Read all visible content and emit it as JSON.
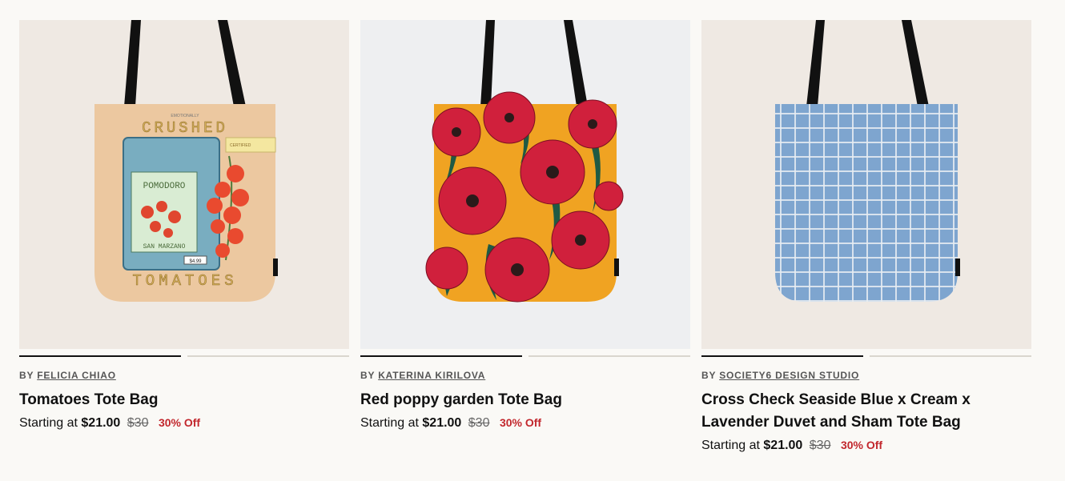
{
  "products": [
    {
      "by_prefix": "BY",
      "artist": "FELICIA CHIAO",
      "title": "Tomatoes Tote Bag",
      "price_prefix": "Starting at",
      "price": "$21.00",
      "original_price": "$30",
      "discount": "30% Off",
      "art": {
        "top": "EMOTIONALLY",
        "headline": "CRUSHED",
        "bottom": "TOMATOES",
        "can": "POMODORO",
        "can2": "SAN MARZANO",
        "tag": "$4.99",
        "note": "CERTIFIED"
      }
    },
    {
      "by_prefix": "BY",
      "artist": "KATERINA KIRILOVA",
      "title": "Red poppy garden Tote Bag",
      "price_prefix": "Starting at",
      "price": "$21.00",
      "original_price": "$30",
      "discount": "30% Off"
    },
    {
      "by_prefix": "BY",
      "artist": "SOCIETY6 DESIGN STUDIO",
      "title": "Cross Check Seaside Blue x Cream x Lavender Duvet and Sham Tote Bag",
      "price_prefix": "Starting at",
      "price": "$21.00",
      "original_price": "$30",
      "discount": "30% Off"
    }
  ],
  "colors": {
    "discount": "#c2272d",
    "indicator_active": "#111111",
    "indicator_inactive": "#d9d6ce"
  }
}
